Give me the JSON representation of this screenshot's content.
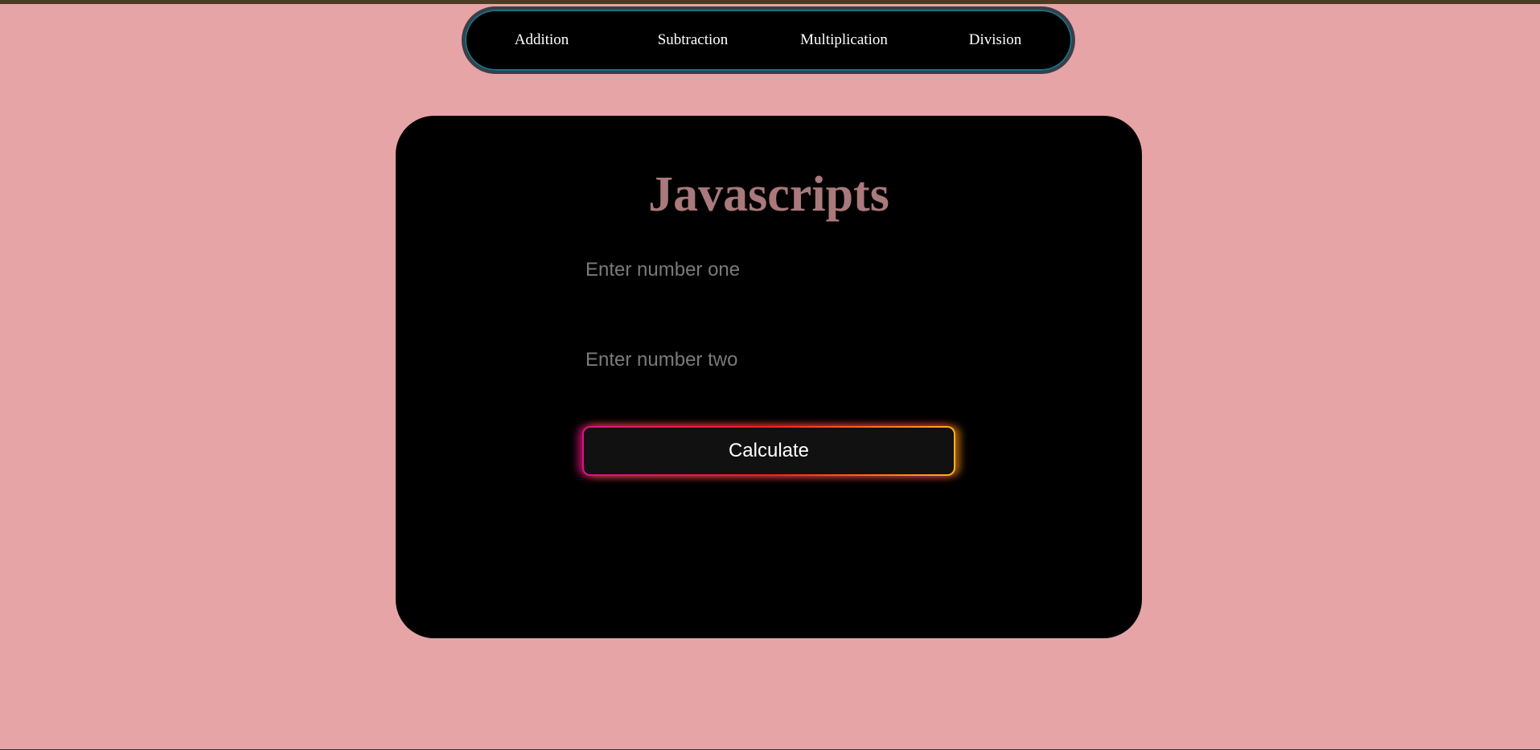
{
  "nav": {
    "items": [
      {
        "label": "Addition"
      },
      {
        "label": "Subtraction"
      },
      {
        "label": "Multiplication"
      },
      {
        "label": "Division"
      }
    ]
  },
  "main": {
    "title": "Javascripts",
    "input_one": {
      "value": "",
      "placeholder": "Enter number one"
    },
    "input_two": {
      "value": "",
      "placeholder": "Enter number two"
    },
    "calculate_label": "Calculate"
  },
  "colors": {
    "page_background": "#e6a4a6",
    "card_background": "#000000",
    "title_color": "#a9797c",
    "button_glow_start": "#e0108a",
    "button_glow_mid": "#ff1a1a",
    "button_glow_end": "#ffb21a"
  }
}
